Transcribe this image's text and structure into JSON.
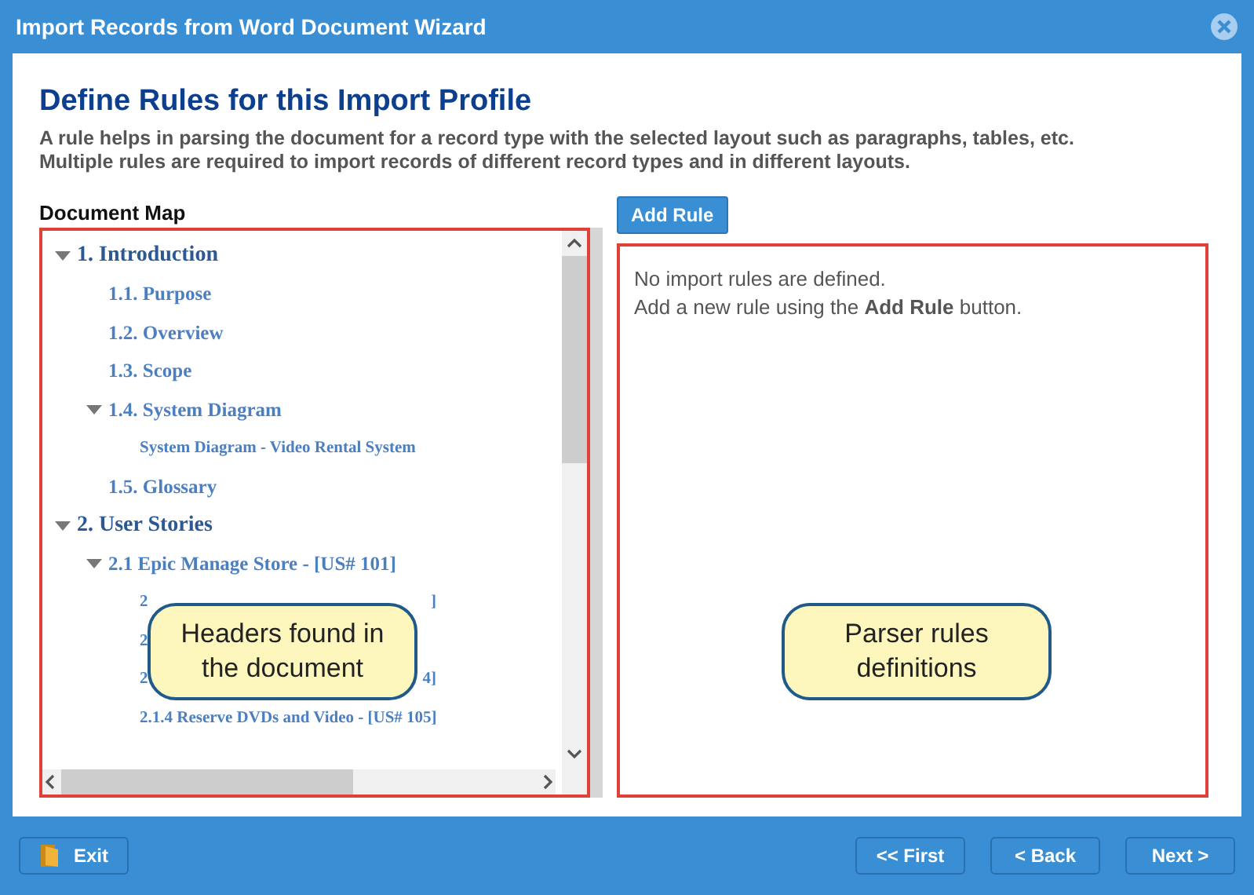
{
  "window": {
    "title": "Import Records from Word Document Wizard"
  },
  "heading": "Define Rules for this Import Profile",
  "description": [
    "A rule helps in parsing the document for a record type with the selected layout such as paragraphs, tables, etc.",
    "Multiple rules are required to import records of different record types and in different layouts."
  ],
  "document_map": {
    "label": "Document Map",
    "tree": [
      {
        "label": "1. Introduction",
        "expanded": true,
        "children": [
          {
            "label": "1.1. Purpose"
          },
          {
            "label": "1.2. Overview"
          },
          {
            "label": "1.3. Scope"
          },
          {
            "label": "1.4. System Diagram",
            "expanded": true,
            "children": [
              {
                "label": "System Diagram - Video Rental System"
              }
            ]
          },
          {
            "label": "1.5. Glossary"
          }
        ]
      },
      {
        "label": "2. User Stories",
        "expanded": true,
        "children": [
          {
            "label": "2.1 Epic Manage Store - [US# 101]",
            "expanded": true,
            "children": [
              {
                "label": "2",
                "tail": "]"
              },
              {
                "label": "2"
              },
              {
                "label": "2",
                "tail": "4]"
              },
              {
                "label": "2.1.4 Reserve DVDs and Video - [US# 105]"
              }
            ]
          }
        ]
      }
    ]
  },
  "add_rule_button": "Add Rule",
  "rules_panel": {
    "empty_lines": [
      "No import rules are defined.",
      "Add a new rule using the **Add Rule** button."
    ]
  },
  "callouts": [
    "Headers found in the document",
    "Parser rules definitions"
  ],
  "buttons": {
    "exit": "Exit",
    "first": "<< First",
    "back": "< Back",
    "next": "Next >"
  }
}
